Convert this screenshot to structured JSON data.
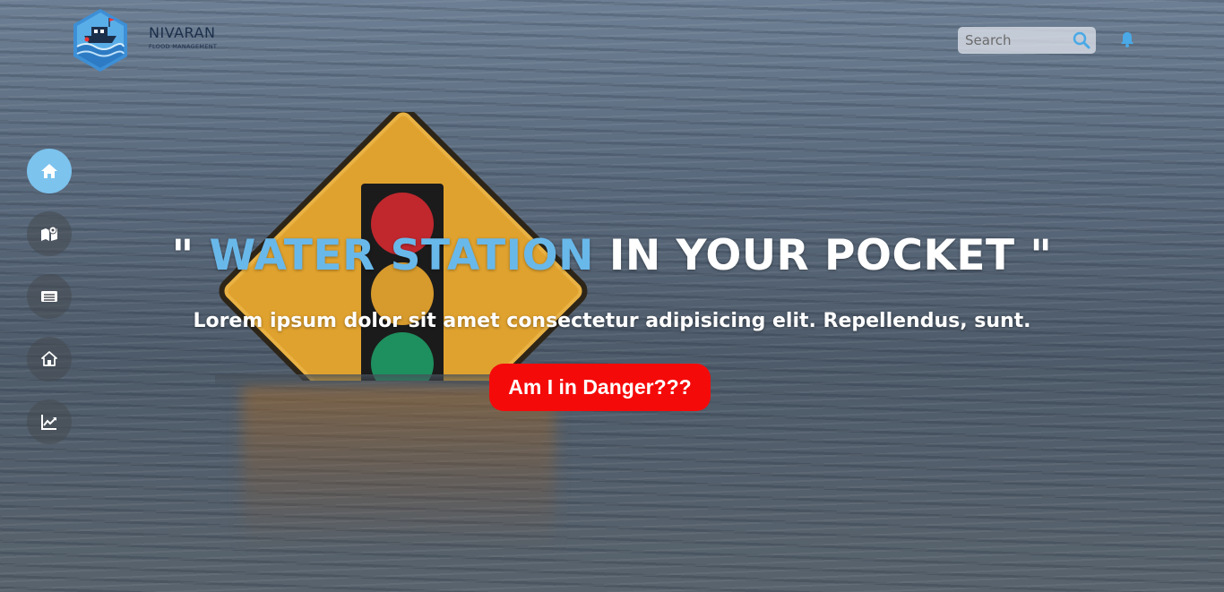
{
  "header": {
    "brand_name": "NIVARAN",
    "brand_tagline": "FLOOD MANAGEMENT",
    "search_placeholder": "Search"
  },
  "icons": {
    "logo": "boat-on-waves-logo",
    "search": "search-icon",
    "notifications": "bell-icon"
  },
  "sidenav": {
    "items": [
      {
        "name": "home",
        "icon": "home-icon",
        "active": true
      },
      {
        "name": "map",
        "icon": "map-pin-icon",
        "active": false
      },
      {
        "name": "news",
        "icon": "newspaper-icon",
        "active": false
      },
      {
        "name": "shelter",
        "icon": "house-icon",
        "active": false
      },
      {
        "name": "analytics",
        "icon": "trend-chart-icon",
        "active": false
      }
    ]
  },
  "hero": {
    "quote_open": "\"",
    "headline_accent": "WATER STATION",
    "headline_rest": "IN YOUR POCKET",
    "quote_close": "\"",
    "subheadline": "Lorem ipsum dolor sit amet consectetur adipisicing elit. Repellendus, sunt.",
    "cta_label": "Am I in Danger???"
  },
  "colors": {
    "accent": "#69b8ea",
    "nav_active": "#7cc3ee",
    "cta": "#f50a0a",
    "brand_text": "#1c2f4a"
  }
}
